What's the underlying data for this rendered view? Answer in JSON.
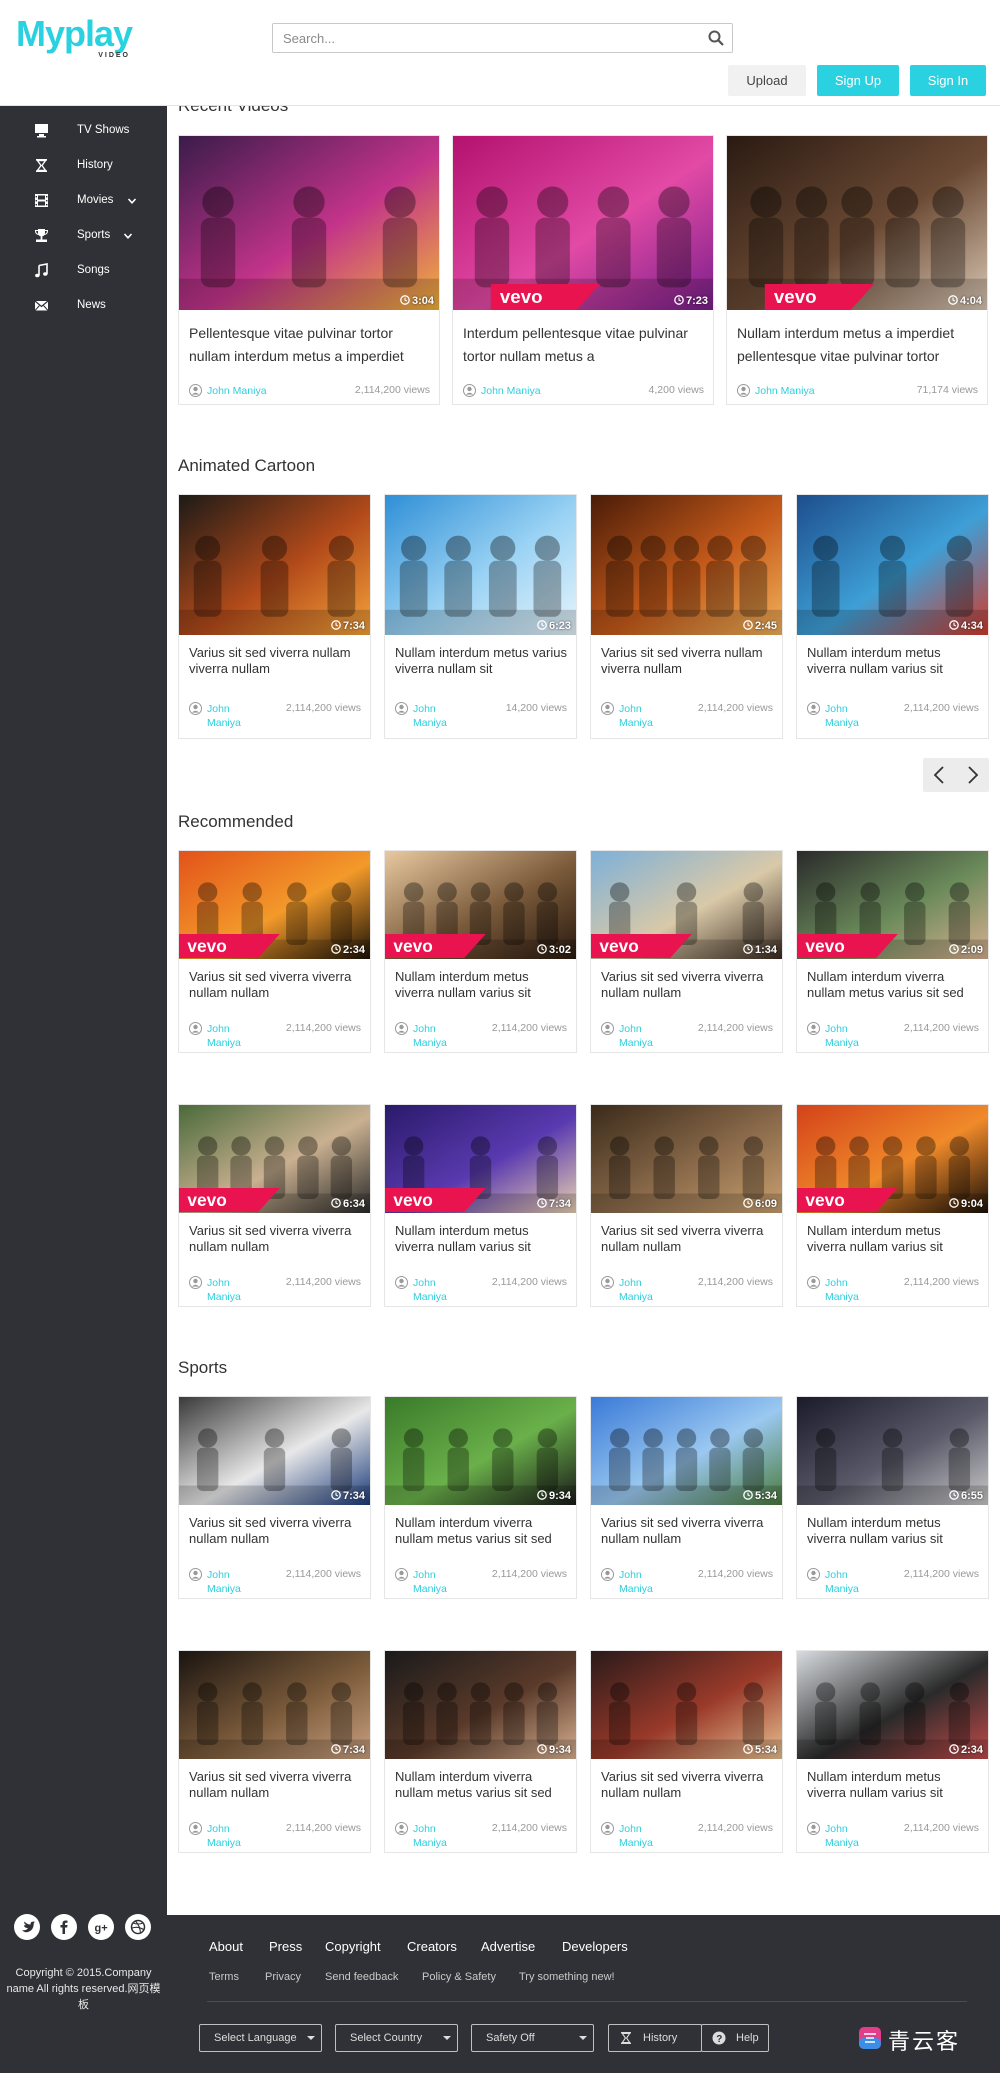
{
  "header": {
    "logo_main": "Myplay",
    "logo_sub": "VIDEO",
    "search_placeholder": "Search...",
    "upload": "Upload",
    "signup": "Sign Up",
    "signin": "Sign In"
  },
  "colors": {
    "accent": "#2ad1e0",
    "sidebar": "#2f3136",
    "vevo": "#e8134f"
  },
  "sidebar": {
    "items": [
      {
        "label": "TV Shows",
        "icon": "tv-icon"
      },
      {
        "label": "History",
        "icon": "hourglass-icon"
      },
      {
        "label": "Movies",
        "icon": "film-icon"
      },
      {
        "label": "Sports",
        "icon": "trophy-icon"
      },
      {
        "label": "Songs",
        "icon": "music-icon"
      },
      {
        "label": "News",
        "icon": "envelope-icon"
      }
    ],
    "social": [
      "twitter-icon",
      "facebook-icon",
      "google-plus-icon",
      "dribbble-icon"
    ],
    "copyright": "Copyright © 2015.Company name All rights reserved.网页模板"
  },
  "sections": [
    {
      "title": "Recent Videos",
      "cards": [
        {
          "title": "Pellentesque vitae pulvinar tortor nullam interdum metus a imperdiet",
          "author": "John Maniya",
          "views": "2,114,200 views",
          "duration": "3:04",
          "vevo": false
        },
        {
          "title": "Interdum pellentesque vitae pulvinar tortor nullam metus a",
          "author": "John Maniya",
          "views": "4,200 views",
          "duration": "7:23",
          "vevo": true
        },
        {
          "title": "Nullam interdum metus a imperdiet pellentesque vitae pulvinar tortor",
          "author": "John Maniya",
          "views": "71,174 views",
          "duration": "4:04",
          "vevo": true
        }
      ]
    },
    {
      "title": "Animated Cartoon",
      "cards": [
        {
          "title": "Varius sit sed viverra nullam viverra nullam",
          "author": "John Maniya",
          "views": "2,114,200 views",
          "duration": "7:34",
          "vevo": false
        },
        {
          "title": "Nullam interdum metus varius viverra nullam sit",
          "author": "John Maniya",
          "views": "14,200 views",
          "duration": "6:23",
          "vevo": false
        },
        {
          "title": "Varius sit sed viverra nullam viverra nullam",
          "author": "John Maniya",
          "views": "2,114,200 views",
          "duration": "2:45",
          "vevo": false
        },
        {
          "title": "Nullam interdum metus viverra nullam varius sit",
          "author": "John Maniya",
          "views": "2,114,200 views",
          "duration": "4:34",
          "vevo": false
        }
      ]
    },
    {
      "title": "Recommended",
      "cards": [
        {
          "title": "Varius sit sed viverra viverra nullam nullam",
          "author": "John Maniya",
          "views": "2,114,200 views",
          "duration": "2:34",
          "vevo": true
        },
        {
          "title": "Nullam interdum metus viverra nullam varius sit",
          "author": "John Maniya",
          "views": "2,114,200 views",
          "duration": "3:02",
          "vevo": true
        },
        {
          "title": "Varius sit sed viverra viverra nullam nullam",
          "author": "John Maniya",
          "views": "2,114,200 views",
          "duration": "1:34",
          "vevo": true
        },
        {
          "title": "Nullam interdum viverra nullam metus varius sit sed",
          "author": "John Maniya",
          "views": "2,114,200 views",
          "duration": "2:09",
          "vevo": true
        },
        {
          "title": "Varius sit sed viverra viverra nullam nullam",
          "author": "John Maniya",
          "views": "2,114,200 views",
          "duration": "6:34",
          "vevo": true
        },
        {
          "title": "Nullam interdum metus viverra nullam varius sit",
          "author": "John Maniya",
          "views": "2,114,200 views",
          "duration": "7:34",
          "vevo": true
        },
        {
          "title": "Varius sit sed viverra viverra nullam nullam",
          "author": "John Maniya",
          "views": "2,114,200 views",
          "duration": "6:09",
          "vevo": false
        },
        {
          "title": "Nullam interdum metus viverra nullam varius sit",
          "author": "John Maniya",
          "views": "2,114,200 views",
          "duration": "9:04",
          "vevo": true
        }
      ]
    },
    {
      "title": "Sports",
      "cards": [
        {
          "title": "Varius sit sed viverra viverra nullam nullam",
          "author": "John Maniya",
          "views": "2,114,200 views",
          "duration": "7:34",
          "vevo": false
        },
        {
          "title": "Nullam interdum viverra nullam metus varius sit sed",
          "author": "John Maniya",
          "views": "2,114,200 views",
          "duration": "9:34",
          "vevo": false
        },
        {
          "title": "Varius sit sed viverra viverra nullam nullam",
          "author": "John Maniya",
          "views": "2,114,200 views",
          "duration": "5:34",
          "vevo": false
        },
        {
          "title": "Nullam interdum metus viverra nullam varius sit",
          "author": "John Maniya",
          "views": "2,114,200 views",
          "duration": "6:55",
          "vevo": false
        },
        {
          "title": "Varius sit sed viverra viverra nullam nullam",
          "author": "John Maniya",
          "views": "2,114,200 views",
          "duration": "7:34",
          "vevo": false
        },
        {
          "title": "Nullam interdum viverra nullam metus varius sit sed",
          "author": "John Maniya",
          "views": "2,114,200 views",
          "duration": "9:34",
          "vevo": false
        },
        {
          "title": "Varius sit sed viverra viverra nullam nullam",
          "author": "John Maniya",
          "views": "2,114,200 views",
          "duration": "5:34",
          "vevo": false
        },
        {
          "title": "Nullam interdum metus viverra nullam varius sit",
          "author": "John Maniya",
          "views": "2,114,200 views",
          "duration": "2:34",
          "vevo": false
        }
      ]
    }
  ],
  "footer": {
    "links": [
      "About",
      "Press",
      "Copyright",
      "Creators",
      "Advertise",
      "Developers"
    ],
    "sublinks": [
      "Terms",
      "Privacy",
      "Send feedback",
      "Policy & Safety",
      "Try something new!"
    ],
    "select_language": "Select Language",
    "select_country": "Select Country",
    "safety": "Safety Off",
    "history": "History",
    "help": "Help",
    "watermark": "青云客"
  }
}
